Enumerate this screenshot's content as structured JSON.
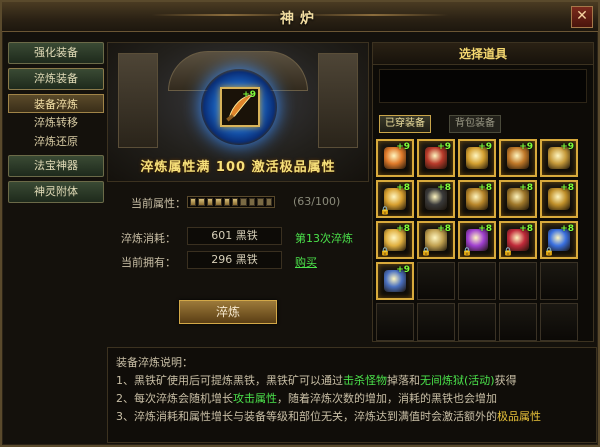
{
  "window": {
    "title": "神炉",
    "close_icon": "close-icon"
  },
  "sidebar": {
    "items": [
      {
        "label": "强化装备"
      },
      {
        "label": "淬炼装备"
      },
      {
        "label": "装备淬炼",
        "active": true
      },
      {
        "label": "淬炼转移"
      },
      {
        "label": "淬炼还原"
      },
      {
        "label": "法宝神器"
      },
      {
        "label": "神灵附体"
      }
    ]
  },
  "stage": {
    "banner": "淬炼属性满 100 激活极品属性",
    "slot_level": "+9",
    "slot_icon": "curved-blade-icon"
  },
  "attribute": {
    "label": "当前属性：",
    "progress": 0.63,
    "segments_total": 10,
    "segments_filled": 6,
    "count": "(63/100)"
  },
  "cost": {
    "consume_label": "淬炼消耗：",
    "consume_value": "601 黑铁",
    "consume_note": "第13次淬炼",
    "own_label": "当前拥有：",
    "own_value": "296 黑铁",
    "buy_link": "购买"
  },
  "action": {
    "label": "淬炼"
  },
  "panel": {
    "title": "选择道具",
    "tabs": [
      {
        "label": "已穿装备",
        "active": true
      },
      {
        "label": "背包装备",
        "active": false
      }
    ],
    "items": [
      {
        "level": "+9",
        "icon": "blade-icon",
        "locked": false,
        "color": "#e07a2a"
      },
      {
        "level": "+9",
        "icon": "armor-icon",
        "locked": false,
        "color": "#b83a2a"
      },
      {
        "level": "+9",
        "icon": "helmet-icon",
        "locked": false,
        "color": "#d4a030"
      },
      {
        "level": "+9",
        "icon": "necklace-icon",
        "locked": false,
        "color": "#c07828"
      },
      {
        "level": "+9",
        "icon": "bracelet-icon",
        "locked": false,
        "color": "#c69a3a"
      },
      {
        "level": "+8",
        "icon": "ring-icon",
        "locked": true,
        "color": "#d8a030"
      },
      {
        "level": "+8",
        "icon": "ring-icon",
        "locked": false,
        "color": "#3a3a3a"
      },
      {
        "level": "+8",
        "icon": "belt-icon",
        "locked": false,
        "color": "#b8862a"
      },
      {
        "level": "+8",
        "icon": "boots-icon",
        "locked": false,
        "color": "#a0782a"
      },
      {
        "level": "+8",
        "icon": "gem-icon",
        "locked": false,
        "color": "#c0902a"
      },
      {
        "level": "+8",
        "icon": "medal-icon",
        "locked": true,
        "color": "#e0b040"
      },
      {
        "level": "+8",
        "icon": "shield-icon",
        "locked": true,
        "color": "#c0a050"
      },
      {
        "level": "+8",
        "icon": "orb-icon",
        "locked": true,
        "color": "#a040d0"
      },
      {
        "level": "+8",
        "icon": "wings-icon",
        "locked": true,
        "color": "#c02a3a"
      },
      {
        "level": "+8",
        "icon": "crystal-icon",
        "locked": true,
        "color": "#3a70e0"
      },
      {
        "level": "+9",
        "icon": "talisman-icon",
        "locked": false,
        "color": "#4a70c0"
      },
      {
        "level": "",
        "icon": "empty-slot-icon",
        "locked": false,
        "color": ""
      },
      {
        "level": "",
        "icon": "empty-slot-icon",
        "locked": false,
        "color": ""
      },
      {
        "level": "",
        "icon": "empty-slot-icon",
        "locked": false,
        "color": ""
      },
      {
        "level": "",
        "icon": "empty-slot-icon",
        "locked": false,
        "color": ""
      },
      {
        "level": "",
        "icon": "empty-slot-icon",
        "locked": false,
        "color": ""
      },
      {
        "level": "",
        "icon": "empty-slot-icon",
        "locked": false,
        "color": ""
      },
      {
        "level": "",
        "icon": "empty-slot-icon",
        "locked": false,
        "color": ""
      },
      {
        "level": "",
        "icon": "empty-slot-icon",
        "locked": false,
        "color": ""
      },
      {
        "level": "",
        "icon": "empty-slot-icon",
        "locked": false,
        "color": ""
      }
    ]
  },
  "description": {
    "title": "装备淬炼说明：",
    "line1_a": "1、黑铁矿使用后可提炼黑铁，黑铁矿可以通过",
    "line1_hl1": "击杀怪物",
    "line1_b": "掉落和",
    "line1_hl2": "无间炼狱(活动)",
    "line1_c": "获得",
    "line2_a": "2、每次淬炼会随机增长",
    "line2_hl": "攻击属性",
    "line2_b": "，随着淬炼次数的增加，消耗的黑铁也会增加",
    "line3_a": "3、淬炼消耗和属性增长与装备等级和部位无关，淬炼达到满值时会激活额外的",
    "line3_hl": "极品属性"
  }
}
